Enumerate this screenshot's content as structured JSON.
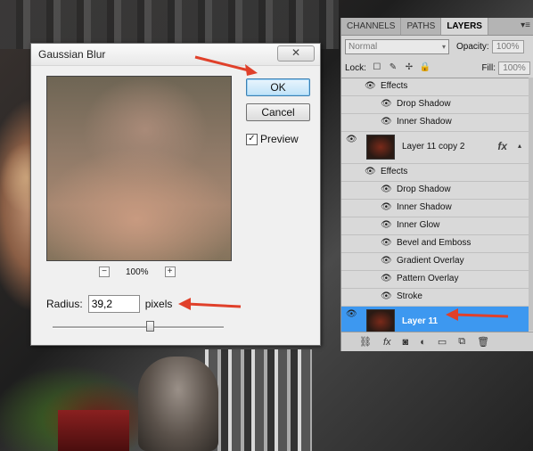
{
  "dialog": {
    "title": "Gaussian Blur",
    "close_label": "✕",
    "ok_label": "OK",
    "cancel_label": "Cancel",
    "preview_label": "Preview",
    "preview_checked": "✓",
    "zoom_minus": "−",
    "zoom_value": "100%",
    "zoom_plus": "+",
    "radius_label": "Radius:",
    "radius_value": "39,2",
    "radius_unit": "pixels",
    "slider_fraction": 0.57
  },
  "panel": {
    "tabs": [
      "CHANNELS",
      "PATHS",
      "LAYERS"
    ],
    "menu_icon": "▾≡",
    "blend_mode": "Normal",
    "blend_arrow": "▾",
    "opacity_label": "Opacity:",
    "opacity_value": "100%",
    "lock_label": "Lock:",
    "fill_label": "Fill:",
    "fill_value": "100%",
    "lock_icons": [
      "☐",
      "✎",
      "✢",
      "🔒"
    ],
    "layers": [
      {
        "kind": "effects",
        "label": "Effects"
      },
      {
        "kind": "effect",
        "label": "Drop Shadow"
      },
      {
        "kind": "effect",
        "label": "Inner Shadow"
      },
      {
        "kind": "layer",
        "label": "Layer 11 copy 2",
        "fx": "fx"
      },
      {
        "kind": "effects",
        "label": "Effects"
      },
      {
        "kind": "effect",
        "label": "Drop Shadow"
      },
      {
        "kind": "effect",
        "label": "Inner Shadow"
      },
      {
        "kind": "effect",
        "label": "Inner Glow"
      },
      {
        "kind": "effect",
        "label": "Bevel and Emboss"
      },
      {
        "kind": "effect",
        "label": "Gradient Overlay"
      },
      {
        "kind": "effect",
        "label": "Pattern Overlay"
      },
      {
        "kind": "effect",
        "label": "Stroke"
      },
      {
        "kind": "selected",
        "label": "Layer 11"
      }
    ],
    "footer_icons": [
      "link-icon",
      "fx-icon",
      "mask-icon",
      "adjustment-icon",
      "folder-icon",
      "new-layer-icon",
      "trash-icon"
    ]
  },
  "colors": {
    "accent": "#3d98f0",
    "arrow": "#e0402a"
  }
}
